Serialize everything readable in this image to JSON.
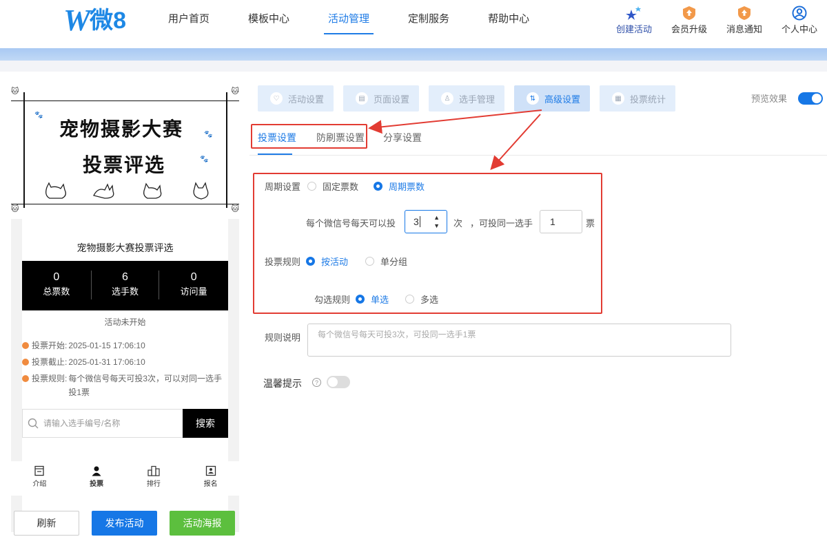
{
  "brand": {
    "logo_w": "W",
    "logo_text": "微8"
  },
  "nav": {
    "items": [
      "用户首页",
      "模板中心",
      "活动管理",
      "定制服务",
      "帮助中心"
    ],
    "active_index": 2
  },
  "tools": {
    "items": [
      "创建活动",
      "会员升级",
      "消息通知",
      "个人中心"
    ]
  },
  "preview_card": {
    "cover_title_1": "宠物摄影大赛",
    "cover_title_2": "投票评选",
    "title": "宠物摄影大赛投票评选",
    "stats": [
      {
        "value": "0",
        "label": "总票数"
      },
      {
        "value": "6",
        "label": "选手数"
      },
      {
        "value": "0",
        "label": "访问量"
      }
    ],
    "status": "活动未开始",
    "info": [
      {
        "key": "投票开始:",
        "value": "2025-01-15 17:06:10"
      },
      {
        "key": "投票截止:",
        "value": "2025-01-31 17:06:10"
      },
      {
        "key": "投票规则:",
        "value": "每个微信号每天可投3次，可以对同一选手投1票"
      }
    ],
    "search_placeholder": "请输入选手编号/名称",
    "search_button": "搜索",
    "bottom_nav": [
      "介绍",
      "投票",
      "排行",
      "报名"
    ]
  },
  "actions": {
    "refresh": "刷新",
    "publish": "发布活动",
    "poster": "活动海报"
  },
  "tabs": [
    {
      "label": "活动设置",
      "icon": "heart-icon"
    },
    {
      "label": "页面设置",
      "icon": "page-icon"
    },
    {
      "label": "选手管理",
      "icon": "user-icon"
    },
    {
      "label": "高级设置",
      "icon": "sliders-icon",
      "active": true
    },
    {
      "label": "投票统计",
      "icon": "chart-icon"
    }
  ],
  "preview_toggle": {
    "label": "预览效果",
    "on": true
  },
  "subtabs": {
    "items": [
      "投票设置",
      "防刷票设置",
      "分享设置"
    ],
    "active_index": 0
  },
  "form": {
    "cycle_label": "周期设置",
    "cycle_options": [
      "固定票数",
      "周期票数"
    ],
    "cycle_selected": 1,
    "per_day_prefix": "每个微信号每天可以投",
    "per_day_value": "3",
    "per_day_unit": "次",
    "same_prefix": "，可投同一选手",
    "same_value": "1",
    "same_unit": "票",
    "rule_label": "投票规则",
    "rule_options": [
      "按活动",
      "单分组"
    ],
    "rule_selected": 0,
    "check_label": "勾选规则",
    "check_options": [
      "单选",
      "多选"
    ],
    "check_selected": 0,
    "desc_label": "规则说明",
    "desc_placeholder": "每个微信号每天可投3次，可投同一选手1票",
    "tip_label": "温馨提示",
    "tip_on": false
  },
  "colors": {
    "accent": "#1677e6",
    "highlight": "#e23b32",
    "success": "#5cbf3e",
    "warning": "#f08b3f"
  }
}
